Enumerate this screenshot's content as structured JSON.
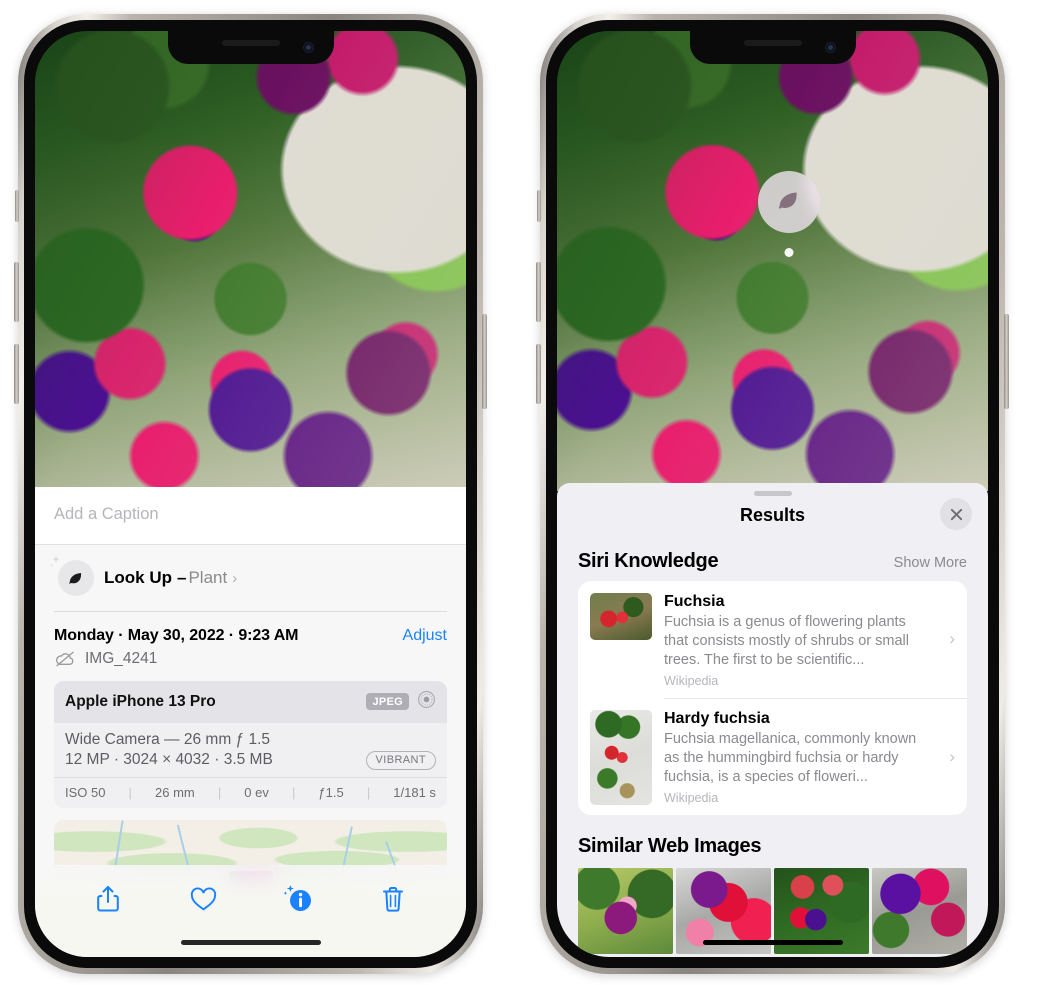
{
  "left_phone": {
    "name": "iphone-photo-info-view",
    "caption": {
      "placeholder": "Add a Caption",
      "value": ""
    },
    "lookup": {
      "icon": "leaf-icon",
      "sparkle_icon": "sparkle-icon",
      "label": "Look Up",
      "dash": " – ",
      "subject": "Plant",
      "chevron": "›"
    },
    "meta": {
      "datetime": "Monday · May 30, 2022 · 9:23 AM",
      "adjust_label": "Adjust",
      "cloud_icon": "cloud-slash-icon",
      "filename": "IMG_4241"
    },
    "exif": {
      "device": "Apple iPhone 13 Pro",
      "format_badge": "JPEG",
      "hdr_icon": "aperture-icon",
      "lens_line": "Wide Camera — 26 mm ƒ 1.5",
      "size_line": "12 MP · 3024 × 4032 · 3.5 MB",
      "style_pill": "VIBRANT",
      "stats": [
        "ISO 50",
        "26 mm",
        "0 ev",
        "ƒ1.5",
        "1/181 s"
      ]
    },
    "map": {
      "name": "location-map-preview"
    },
    "toolbar": [
      {
        "name": "share-button",
        "icon": "share-icon"
      },
      {
        "name": "favorite-button",
        "icon": "heart-icon"
      },
      {
        "name": "info-button",
        "icon": "info-sparkle-icon"
      },
      {
        "name": "delete-button",
        "icon": "trash-icon"
      }
    ]
  },
  "right_phone": {
    "name": "iphone-visual-lookup-results",
    "photo_badge": {
      "icon": "leaf-icon",
      "name": "visual-lookup-leaf-badge"
    },
    "sheet": {
      "grabber": "sheet-grabber",
      "title": "Results",
      "close_icon": "close-icon"
    },
    "siri_knowledge": {
      "title": "Siri Knowledge",
      "show_more": "Show More",
      "items": [
        {
          "title": "Fuchsia",
          "description": "Fuchsia is a genus of flowering plants that consists mostly of shrubs or small trees. The first to be scientific...",
          "source": "Wikipedia",
          "chevron": "›"
        },
        {
          "title": "Hardy fuchsia",
          "description": "Fuchsia magellanica, commonly known as the hummingbird fuchsia or hardy fuchsia, is a species of floweri...",
          "source": "Wikipedia",
          "chevron": "›"
        }
      ]
    },
    "similar_web_images": {
      "title": "Similar Web Images",
      "thumbs": [
        {
          "name": "web-image-1"
        },
        {
          "name": "web-image-2"
        },
        {
          "name": "web-image-3"
        },
        {
          "name": "web-image-4"
        }
      ]
    }
  },
  "colors": {
    "accent_blue": "#1a82ff",
    "sheet_bg": "#efeff4",
    "card_bg": "#ffffff",
    "secondary_text": "#8a8a8f",
    "badge_gray": "#aeaeb4"
  }
}
